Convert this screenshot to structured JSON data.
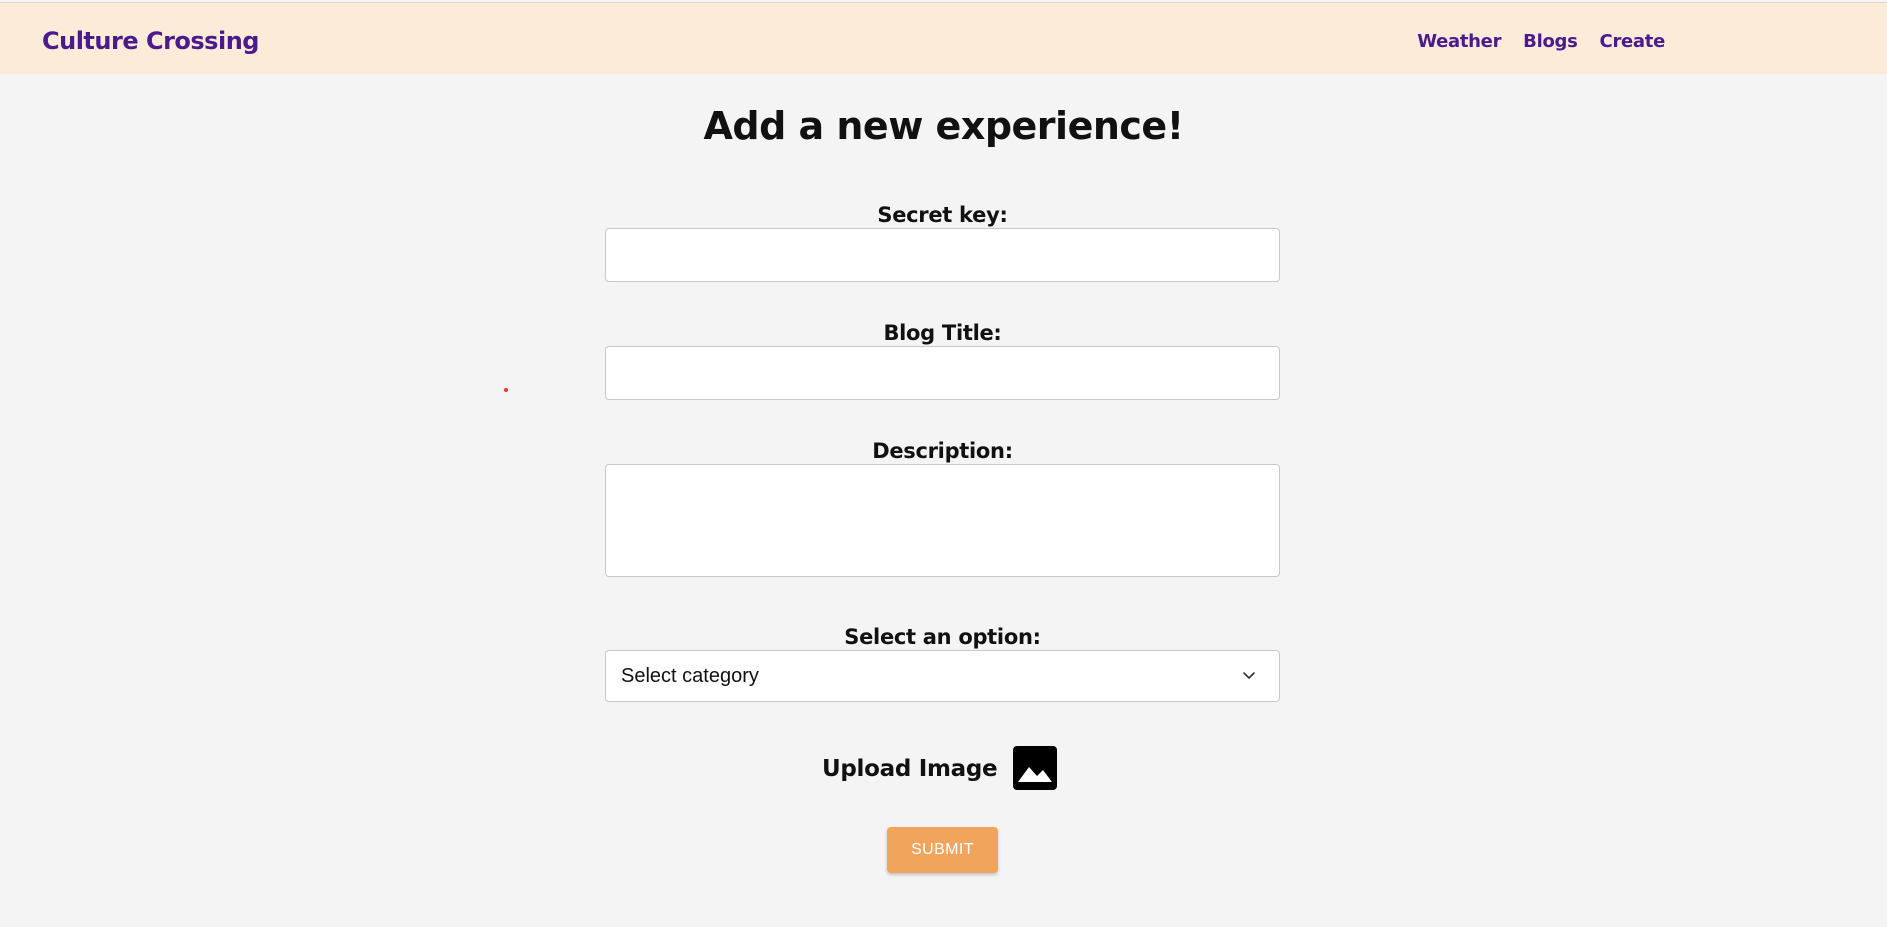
{
  "header": {
    "brand": "Culture Crossing",
    "nav": [
      {
        "label": "Weather"
      },
      {
        "label": "Blogs"
      },
      {
        "label": "Create"
      }
    ]
  },
  "form": {
    "title": "Add a new experience!",
    "secret_key": {
      "label": "Secret key:",
      "value": ""
    },
    "blog_title": {
      "label": "Blog Title:",
      "value": ""
    },
    "description": {
      "label": "Description:",
      "value": ""
    },
    "category": {
      "label": "Select an option:",
      "selected": "Select category"
    },
    "upload": {
      "label": "Upload Image",
      "icon": "image-icon"
    },
    "submit_label": "SUBMIT"
  },
  "colors": {
    "brand": "#4b1a8c",
    "header_bg": "#fbebd8",
    "page_bg": "#f4f4f4",
    "submit_bg": "#f0a45c"
  }
}
